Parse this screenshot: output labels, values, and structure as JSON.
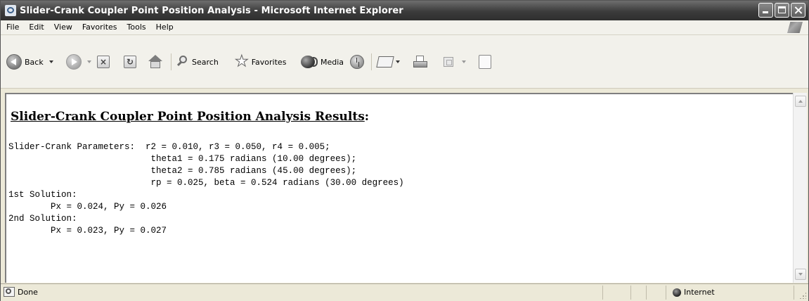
{
  "window": {
    "title": "Slider-Crank Coupler Point Position Analysis - Microsoft Internet Explorer"
  },
  "menu": [
    "File",
    "Edit",
    "View",
    "Favorites",
    "Tools",
    "Help"
  ],
  "toolbar": {
    "back_label": "Back",
    "search_label": "Search",
    "favorites_label": "Favorites",
    "media_label": "Media"
  },
  "page": {
    "heading": "Slider-Crank Coupler Point Position Analysis Results",
    "heading_suffix": ":",
    "lines": [
      "Slider-Crank Parameters:  r2 = 0.010, r3 = 0.050, r4 = 0.005;",
      "                           theta1 = 0.175 radians (10.00 degrees);",
      "                           theta2 = 0.785 radians (45.00 degrees);",
      "                           rp = 0.025, beta = 0.524 radians (30.00 degrees)",
      "1st Solution:",
      "        Px = 0.024, Py = 0.026",
      "2nd Solution:",
      "        Px = 0.023, Py = 0.027"
    ]
  },
  "status": {
    "text": "Done",
    "zone": "Internet"
  }
}
